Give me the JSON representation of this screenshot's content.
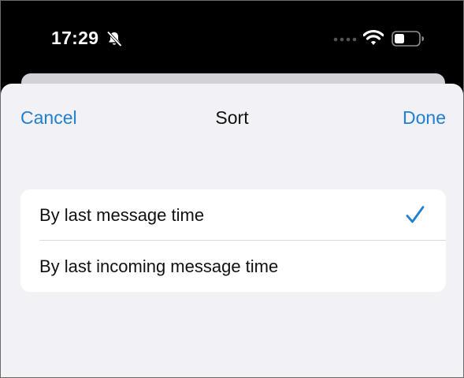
{
  "status_bar": {
    "time": "17:29",
    "icons": {
      "mute": "bell-slash-icon",
      "signal": "signal-dots-icon",
      "wifi": "wifi-icon",
      "battery": "battery-icon"
    }
  },
  "sheet": {
    "title": "Sort",
    "cancel_label": "Cancel",
    "done_label": "Done",
    "options": [
      {
        "label": "By last message time",
        "selected": true
      },
      {
        "label": "By last incoming message time",
        "selected": false
      }
    ]
  },
  "colors": {
    "accent": "#1f7fd1",
    "sheet_background": "#f1f1f6",
    "status_bar_background": "#000000"
  }
}
